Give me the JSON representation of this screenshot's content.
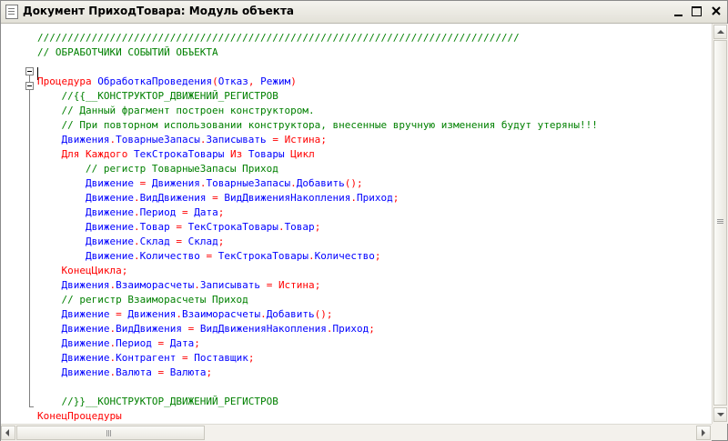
{
  "window": {
    "title": "Документ ПриходТовара: Модуль объекта"
  },
  "code": {
    "lines": [
      {
        "t": "////////////////////////////////////////////////////////////////////////////////",
        "c": "comment"
      },
      {
        "t": "// ОБРАБОТЧИКИ СОБЫТИЙ ОБЪЕКТА",
        "c": "comment"
      },
      {
        "t": "",
        "c": "id"
      },
      {
        "t": "Процедура ОбработкаПроведения(Отказ, Режим)",
        "c": "proc"
      },
      {
        "t": "    //{{__КОНСТРУКТОР_ДВИЖЕНИЙ_РЕГИСТРОВ",
        "c": "comment"
      },
      {
        "t": "    // Данный фрагмент построен конструктором.",
        "c": "comment"
      },
      {
        "t": "    // При повторном использовании конструктора, внесенные вручную изменения будут утеряны!!!",
        "c": "comment"
      },
      {
        "t": "    Движения.ТоварныеЗапасы.Записывать = Истина;",
        "c": "assign"
      },
      {
        "t": "    Для Каждого ТекСтрокаТовары Из Товары Цикл",
        "c": "for"
      },
      {
        "t": "        // регистр ТоварныеЗапасы Приход",
        "c": "comment"
      },
      {
        "t": "        Движение = Движения.ТоварныеЗапасы.Добавить();",
        "c": "id"
      },
      {
        "t": "        Движение.ВидДвижения = ВидДвиженияНакопления.Приход;",
        "c": "id"
      },
      {
        "t": "        Движение.Период = Дата;",
        "c": "id"
      },
      {
        "t": "        Движение.Товар = ТекСтрокаТовары.Товар;",
        "c": "id"
      },
      {
        "t": "        Движение.Склад = Склад;",
        "c": "id"
      },
      {
        "t": "        Движение.Количество = ТекСтрокаТовары.Количество;",
        "c": "id"
      },
      {
        "t": "    КонецЦикла;",
        "c": "kw"
      },
      {
        "t": "    Движения.Взаиморасчеты.Записывать = Истина;",
        "c": "assign"
      },
      {
        "t": "    // регистр Взаиморасчеты Приход",
        "c": "comment"
      },
      {
        "t": "    Движение = Движения.Взаиморасчеты.Добавить();",
        "c": "id"
      },
      {
        "t": "    Движение.ВидДвижения = ВидДвиженияНакопления.Приход;",
        "c": "id"
      },
      {
        "t": "    Движение.Период = Дата;",
        "c": "id"
      },
      {
        "t": "    Движение.Контрагент = Поставщик;",
        "c": "id"
      },
      {
        "t": "    Движение.Валюта = Валюта;",
        "c": "id"
      },
      {
        "t": "",
        "c": "id"
      },
      {
        "t": "    //}}__КОНСТРУКТОР_ДВИЖЕНИЙ_РЕГИСТРОВ",
        "c": "comment"
      },
      {
        "t": "КонецПроцедуры",
        "c": "kw"
      }
    ]
  },
  "colors": {
    "comment": "#008000",
    "keyword": "#ff0000",
    "identifier": "#0000ff"
  }
}
